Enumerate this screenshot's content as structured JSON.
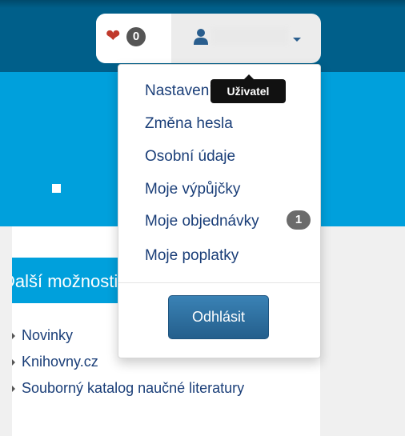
{
  "header": {
    "favorites_count": "0",
    "user_name": "Uživatel"
  },
  "tooltip": {
    "text": "Uživatel"
  },
  "user_menu": {
    "items": [
      {
        "label": "Nastavení"
      },
      {
        "label": "Změna hesla"
      },
      {
        "label": "Osobní údaje"
      },
      {
        "label": "Moje výpůjčky"
      },
      {
        "label": "Moje objednávky",
        "badge": "1"
      },
      {
        "label": "Moje poplatky"
      }
    ],
    "logout_label": "Odhlásit"
  },
  "sidebar": {
    "heading": "Další možnosti",
    "links": [
      {
        "label": "Novinky"
      },
      {
        "label": "Knihovny.cz"
      },
      {
        "label": "Souborný katalog naučné literatury"
      }
    ]
  },
  "colors": {
    "topbar": "#005f8a",
    "hero": "#00a0dc",
    "link": "#1a3e78",
    "heart": "#c0392b",
    "button": "#245f8c"
  },
  "icons": {
    "favorites": "heart-icon",
    "user": "user-icon",
    "dropdown": "caret-down-icon",
    "list_bullet": "triangle-right-icon"
  }
}
